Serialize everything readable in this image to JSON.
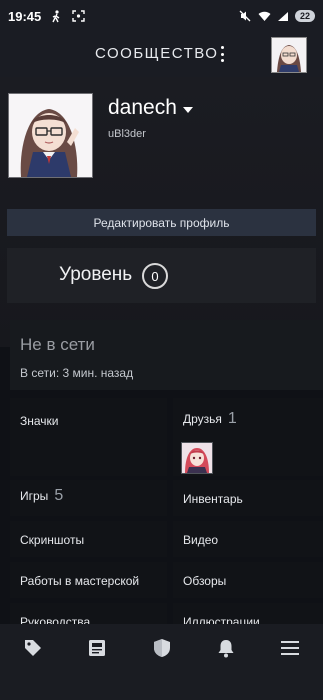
{
  "status_bar": {
    "time": "19:45",
    "battery": "22"
  },
  "header": {
    "title": "СООБЩЕСТВО",
    "menu_icon": "more-vert-icon"
  },
  "profile": {
    "username": "danech",
    "handle": "uBl3der",
    "edit_button": "Редактировать профиль",
    "level_label": "Уровень",
    "level_value": "0"
  },
  "presence": {
    "status": "Не в сети",
    "last_seen": "В сети: 3 мин. назад"
  },
  "grid": {
    "badges": "Значки",
    "friends": "Друзья",
    "friends_count": "1",
    "games": "Игры",
    "games_count": "5",
    "inventory": "Инвентарь",
    "screenshots": "Скриншоты",
    "videos": "Видео",
    "workshop": "Работы в мастерской",
    "reviews": "Обзоры",
    "guides": "Руководства",
    "artwork": "Иллюстрации"
  },
  "bottom_nav": {
    "items": [
      "store-tag-icon",
      "news-icon",
      "shield-icon",
      "bell-icon",
      "hamburger-menu-icon"
    ]
  },
  "colors": {
    "background": "#0f1116",
    "header": "#1a1c23",
    "edit_button": "#2b3240",
    "tile": "#111317"
  }
}
